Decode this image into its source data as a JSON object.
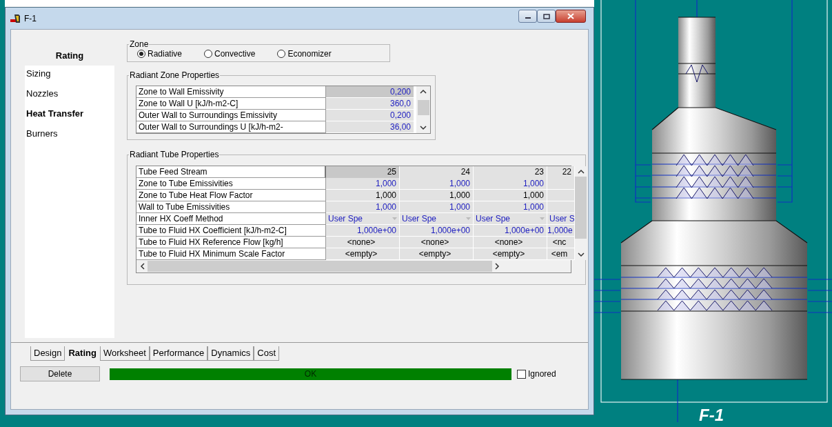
{
  "window": {
    "title": "F-1"
  },
  "sidebar": {
    "header": "Rating",
    "items": [
      {
        "label": "Sizing",
        "selected": false
      },
      {
        "label": "Nozzles",
        "selected": false
      },
      {
        "label": "Heat Transfer",
        "selected": true
      },
      {
        "label": "Burners",
        "selected": false
      }
    ]
  },
  "zone": {
    "title": "Zone",
    "options": [
      {
        "label": "Radiative",
        "selected": true
      },
      {
        "label": "Convective",
        "selected": false
      },
      {
        "label": "Economizer",
        "selected": false
      }
    ]
  },
  "radiant_zone": {
    "title": "Radiant Zone Properties",
    "rows": [
      {
        "label": "Zone to Wall Emissivity",
        "value": "0,200",
        "specified": true
      },
      {
        "label": "Zone to Wall U [kJ/h-m2-C]",
        "value": "360,0",
        "specified": true
      },
      {
        "label": "Outer Wall to Surroundings Emissivity",
        "value": "0,200",
        "specified": true
      },
      {
        "label": "Outer Wall to Surroundings U [kJ/h-m2-",
        "value": "36,00",
        "specified": true
      }
    ]
  },
  "radiant_tube": {
    "title": "Radiant Tube Properties",
    "header_label": "Tube Feed Stream",
    "columns": [
      "25",
      "24",
      "23",
      "22"
    ],
    "rows": [
      {
        "label": "Zone to Tube Emissivities",
        "kind": "number",
        "specified": true,
        "values": [
          "1,000",
          "1,000",
          "1,000"
        ]
      },
      {
        "label": "Zone to Tube Heat Flow Factor",
        "kind": "number",
        "specified": false,
        "values": [
          "1,000",
          "1,000",
          "1,000"
        ]
      },
      {
        "label": "Wall to Tube Emissivities",
        "kind": "number",
        "specified": true,
        "values": [
          "1,000",
          "1,000",
          "1,000"
        ]
      },
      {
        "label": "Inner HX Coeff Method",
        "kind": "dropdown",
        "specified": true,
        "values": [
          "User Spe",
          "User Spe",
          "User Spe",
          "User S"
        ]
      },
      {
        "label": "Tube to Fluid HX Coefficient [kJ/h-m2-C]",
        "kind": "number",
        "specified": true,
        "values": [
          "1,000e+00",
          "1,000e+00",
          "1,000e+00",
          "1,000e"
        ]
      },
      {
        "label": "Tube to Fluid HX Reference Flow [kg/h]",
        "kind": "text",
        "specified": false,
        "values": [
          "<none>",
          "<none>",
          "<none>",
          "<nc"
        ]
      },
      {
        "label": "Tube to Fluid HX Minimum Scale Factor",
        "kind": "text",
        "specified": false,
        "values": [
          "<empty>",
          "<empty>",
          "<empty>",
          "<em"
        ]
      }
    ]
  },
  "tabs": [
    {
      "label": "Design",
      "selected": false
    },
    {
      "label": "Rating",
      "selected": true
    },
    {
      "label": "Worksheet",
      "selected": false
    },
    {
      "label": "Performance",
      "selected": false
    },
    {
      "label": "Dynamics",
      "selected": false
    },
    {
      "label": "Cost",
      "selected": false
    }
  ],
  "delete_button": "Delete",
  "status": {
    "text": "OK",
    "color": "#008000"
  },
  "ignored": {
    "label": "Ignored",
    "checked": false
  },
  "diagram": {
    "label": "F-1"
  }
}
